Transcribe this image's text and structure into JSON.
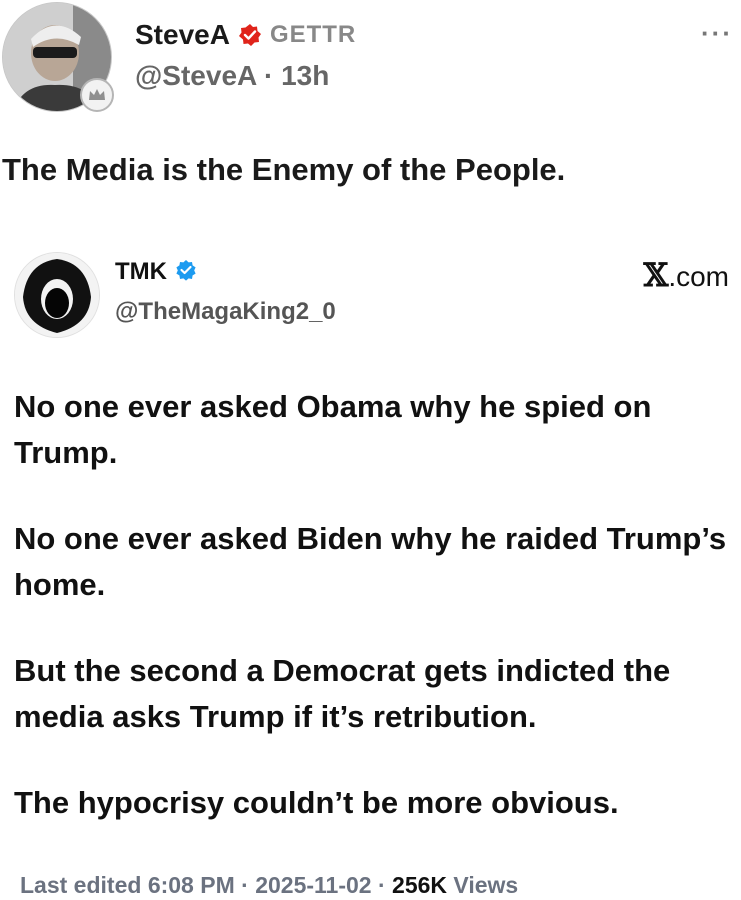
{
  "post": {
    "author_name": "SteveA",
    "platform": "GETTR",
    "handle": "@SteveA",
    "separator": "·",
    "time_ago": "13h",
    "more_label": "···",
    "text": "The Media is the Enemy of the People."
  },
  "quoted": {
    "name": "TMK",
    "handle": "@TheMagaKing2_0",
    "source_x": "𝕏",
    "source_domain": ".com",
    "paragraphs": [
      "No one ever asked Obama why he spied on Trump.",
      "No one ever asked Biden why he raided Trump’s home.",
      "But the second a Democrat gets indicted the media asks Trump if it’s retribution.",
      "The hypocrisy couldn’t be more obvious."
    ],
    "meta": {
      "edited_label": "Last edited",
      "time": "6:08 PM",
      "sep1": "·",
      "date": "2025-11-02",
      "sep2": "·",
      "views_count": "256K",
      "views_label": "Views"
    }
  },
  "colors": {
    "gettr_red": "#e0241b",
    "verified_blue": "#1d9bf0",
    "muted_text": "#6b7280"
  },
  "icons": [
    "verified-badge-icon",
    "gettr-check-icon",
    "x-logo-icon",
    "crown-badge-icon"
  ]
}
